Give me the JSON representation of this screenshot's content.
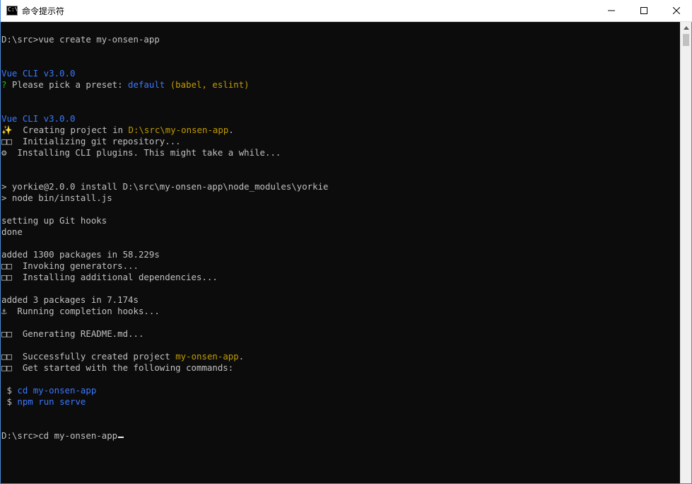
{
  "window": {
    "title": "命令提示符",
    "icon": "cmd-icon",
    "icon_text": "C:\\",
    "controls": [
      "minimize",
      "maximize",
      "close"
    ]
  },
  "colors": {
    "background": "#0c0c0c",
    "default_text": "#c0c0c0",
    "blue": "#3b78ff",
    "green": "#16c60c",
    "yellow": "#c19c00",
    "cursor": "#f2f2f2"
  },
  "terminal": {
    "lines": [
      [
        {
          "t": "D:\\src>vue create my-onsen-app"
        }
      ],
      [],
      [],
      [
        {
          "t": "Vue CLI v3.0.0",
          "c": "blue"
        }
      ],
      [
        {
          "t": "?",
          "c": "green"
        },
        {
          "t": " Please pick a preset: "
        },
        {
          "t": "default",
          "c": "blue"
        },
        {
          "t": " (babel, eslint)",
          "c": "yellow"
        }
      ],
      [],
      [],
      [
        {
          "t": "Vue CLI v3.0.0",
          "c": "blue"
        }
      ],
      [
        {
          "t": "✨  Creating project in "
        },
        {
          "t": "D:\\src\\my-onsen-app",
          "c": "yellow"
        },
        {
          "t": "."
        }
      ],
      [
        {
          "t": "□□  Initializing git repository..."
        }
      ],
      [
        {
          "t": "⚙  Installing CLI plugins. This might take a while..."
        }
      ],
      [],
      [],
      [
        {
          "t": "> yorkie@2.0.0 install D:\\src\\my-onsen-app\\node_modules\\yorkie"
        }
      ],
      [
        {
          "t": "> node bin/install.js"
        }
      ],
      [],
      [
        {
          "t": "setting up Git hooks"
        }
      ],
      [
        {
          "t": "done"
        }
      ],
      [],
      [
        {
          "t": "added 1300 packages in 58.229s"
        }
      ],
      [
        {
          "t": "□□  Invoking generators..."
        }
      ],
      [
        {
          "t": "□□  Installing additional dependencies..."
        }
      ],
      [],
      [
        {
          "t": "added 3 packages in 7.174s"
        }
      ],
      [
        {
          "t": "⚓  Running completion hooks..."
        }
      ],
      [],
      [
        {
          "t": "□□  Generating README.md..."
        }
      ],
      [],
      [
        {
          "t": "□□  Successfully created project "
        },
        {
          "t": "my-onsen-app",
          "c": "yellow"
        },
        {
          "t": "."
        }
      ],
      [
        {
          "t": "□□  Get started with the following commands:"
        }
      ],
      [],
      [
        {
          "t": " $ ",
          "c": "default"
        },
        {
          "t": "cd my-onsen-app",
          "c": "blue"
        }
      ],
      [
        {
          "t": " $ ",
          "c": "default"
        },
        {
          "t": "npm run serve",
          "c": "blue"
        }
      ],
      [],
      [],
      [
        {
          "t": "D:\\src>cd my-onsen-app"
        }
      ]
    ]
  }
}
